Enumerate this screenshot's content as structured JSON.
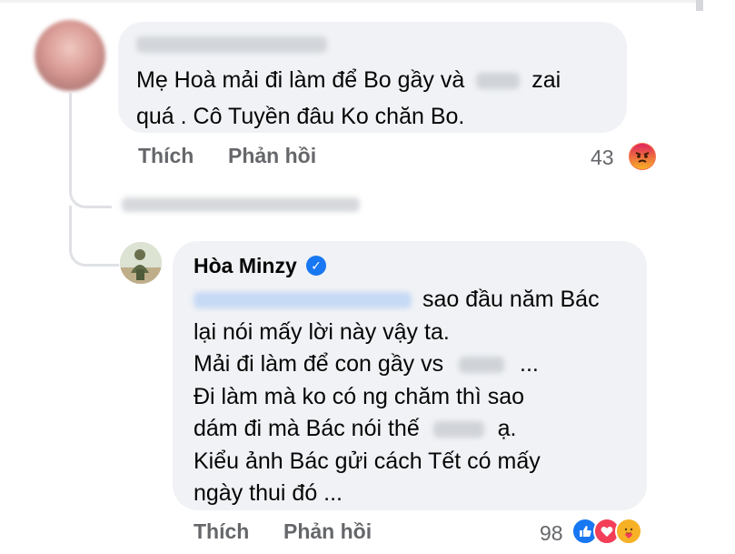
{
  "comment1": {
    "text_line1_a": "Mẹ Hoà mải đi làm để Bo gầy và",
    "text_line1_b": "zai",
    "text_line2": "quá . Cô Tuyền đâu Ko chăn Bo.",
    "like_label": "Thích",
    "reply_label": "Phản hồi",
    "reaction_count": "43",
    "reactions": [
      "angry-icon"
    ]
  },
  "comment2": {
    "author": "Hòa Minzy",
    "verified": true,
    "lines": [
      "sao đầu năm Bác",
      "lại nói mấy lời này vậy ta.",
      "Mải đi làm để con gầy vs",
      "...",
      "Đi làm mà ko có ng chăm thì sao",
      "dám đi mà Bác nói thế",
      "ạ.",
      "Kiểu ảnh Bác gửi cách Tết có mấy",
      "ngày thui đó ..."
    ],
    "like_label": "Thích",
    "reply_label": "Phản hồi",
    "reaction_count": "98",
    "reactions": [
      "like-icon",
      "love-icon",
      "care-icon"
    ]
  },
  "colors": {
    "bubble": "#f0f2f5",
    "secondary_text": "#65676b",
    "like_blue": "#1877f2",
    "love_red": "#f33e58",
    "angry_orange": "#f7714c",
    "care_yellow": "#f7b125"
  }
}
